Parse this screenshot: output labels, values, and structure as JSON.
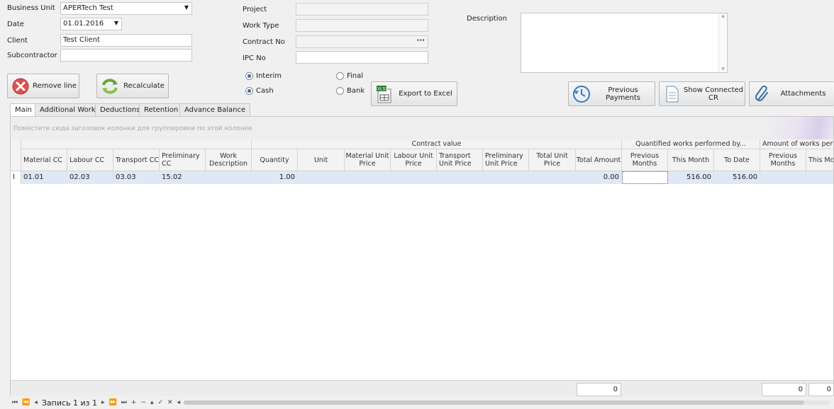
{
  "form": {
    "business_unit_label": "Business Unit",
    "business_unit_value": "APERTech Test",
    "date_label": "Date",
    "date_value": "01.01.2016",
    "client_label": "Client",
    "client_value": "Test Client",
    "subcontractor_label": "Subcontractor",
    "subcontractor_value": "",
    "project_label": "Project",
    "work_type_label": "Work Type",
    "contract_no_label": "Contract No",
    "contract_no_ellipsis": "···",
    "ipc_no_label": "IPC No",
    "description_label": "Description"
  },
  "buttons": {
    "remove_line": "Remove line",
    "recalculate": "Recalculate",
    "export_excel": "Export to Excel",
    "previous_payments": "Previous Payments",
    "show_connected_cr": "Show Connected CR",
    "attachments": "Attachments"
  },
  "radios": {
    "interim": "Interim",
    "final": "Final",
    "cash": "Cash",
    "bank": "Bank"
  },
  "tabs": [
    "Main",
    "Additional Works",
    "Deductions",
    "Retention",
    "Advance Balance"
  ],
  "grid": {
    "group_panel_hint": "Поместите сюда заголовок колонки для группировки по этой колонке",
    "band_contract_value": "Contract value",
    "band_quantified": "Quantified works performed by...",
    "band_amount": "Amount of works perform",
    "columns": [
      "Material CC",
      "Labour CC",
      "Transport CC",
      "Preliminary CC",
      "Work Description",
      "Quantity",
      "Unit",
      "Material Unit Price",
      "Labour Unit Price",
      "Transport Unit Price",
      "Preliminary Unit Price",
      "Total Unit Price",
      "Total Amount",
      "Previous Months",
      "This Month",
      "To Date",
      "Previous Months",
      "This Mo"
    ],
    "row_indicator": "I",
    "row": [
      "01.01",
      "02.03",
      "03.03",
      "15.02",
      "",
      "1.00",
      "",
      "",
      "",
      "",
      "",
      "",
      "0.00",
      "",
      "516.00",
      "516.00",
      "",
      ""
    ],
    "summary": [
      "0",
      "0",
      "0"
    ]
  },
  "navigator": {
    "record_text": "Запись 1 из 1"
  }
}
